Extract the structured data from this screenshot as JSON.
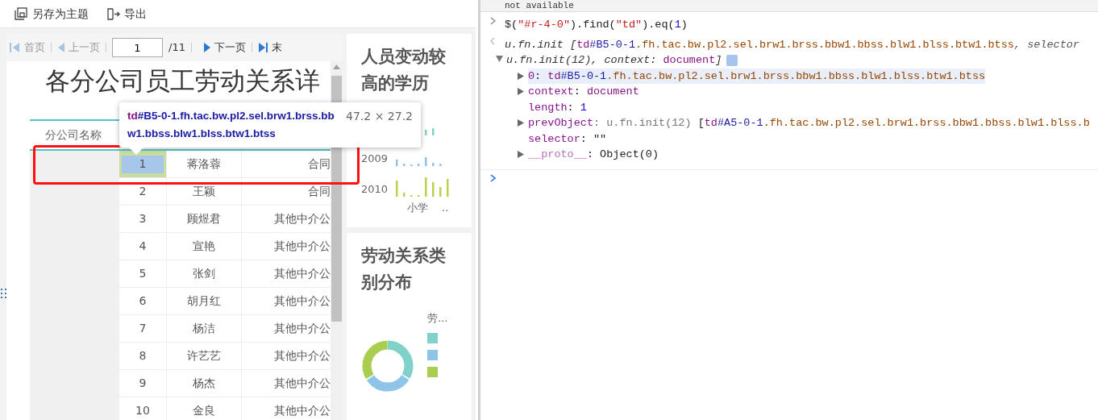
{
  "toolbar": {
    "buttons": [
      {
        "label": "另存为主题",
        "kind": "save"
      },
      {
        "label": "导出",
        "kind": "export"
      }
    ]
  },
  "pager": {
    "items": [
      {
        "label": "首页",
        "kind": "first",
        "disabled": true
      },
      {
        "label": "上一页",
        "kind": "prev",
        "disabled": true
      },
      {
        "label": "下一页",
        "kind": "next",
        "disabled": false
      },
      {
        "label": "末",
        "kind": "last",
        "disabled": false
      }
    ],
    "page": "1",
    "total": "/11"
  },
  "report": {
    "title": "各分公司员工劳动关系详",
    "header": "分公司名称",
    "rows": [
      {
        "number": "1",
        "name": "蒋洛蓉",
        "type": "合同",
        "selected": true
      },
      {
        "number": "2",
        "name": "王颖",
        "type": "合同",
        "selected": false
      },
      {
        "number": "3",
        "name": "顾煜君",
        "type": "其他中介公",
        "selected": false
      },
      {
        "number": "4",
        "name": "宣艳",
        "type": "其他中介公",
        "selected": false
      },
      {
        "number": "5",
        "name": "张剑",
        "type": "其他中介公",
        "selected": false
      },
      {
        "number": "6",
        "name": "胡月红",
        "type": "其他中介公",
        "selected": false
      },
      {
        "number": "7",
        "name": "杨洁",
        "type": "其他中介公",
        "selected": false
      },
      {
        "number": "8",
        "name": "许艺艺",
        "type": "其他中介公",
        "selected": false
      },
      {
        "number": "9",
        "name": "杨杰",
        "type": "其他中介公",
        "selected": false
      },
      {
        "number": "10",
        "name": "金良",
        "type": "其他中介公",
        "selected": false
      }
    ]
  },
  "inspector_tooltip": {
    "tag": "td",
    "id": "#B5-0-1",
    "classes": ".fh.tac.bw.pl2.sel.brw1.brss.bbw1.bbss.blw1.blss.btw1.btss",
    "size": "47.2 × 27.2"
  },
  "charts": [
    {
      "kind": "bars",
      "title": "人员变动较高的学历",
      "years": [
        "2009",
        "2010"
      ],
      "x_labels": [
        "小学",
        ".."
      ]
    },
    {
      "kind": "donut",
      "title": "劳动关系类别分布",
      "legend_title": "劳...",
      "legend": [
        {
          "color": "#7fd1c9"
        },
        {
          "color": "#8ec3ea"
        },
        {
          "color": "#a9cd4e"
        }
      ]
    }
  ],
  "console": {
    "top_message": "not available",
    "lines": [
      {
        "kind": "input",
        "segments": [
          {
            "text": "$(",
            "kind": "plain"
          },
          {
            "text": "\"#r-4-0\"",
            "kind": "string"
          },
          {
            "text": ").find(",
            "kind": "plain"
          },
          {
            "text": "\"td\"",
            "kind": "string"
          },
          {
            "text": ").eq(",
            "kind": "plain"
          },
          {
            "text": "1",
            "kind": "number"
          },
          {
            "text": ")",
            "kind": "plain"
          }
        ]
      },
      {
        "kind": "result",
        "segments": [
          {
            "text": "u.fn.init [",
            "kind": "italic"
          },
          {
            "text": "td",
            "kind": "tag"
          },
          {
            "text": "#B5-0-1",
            "kind": "id"
          },
          {
            "text": ".fh.tac.bw.pl2.sel.brw1.brss.bbw1.bbss.blw1.blss.btw1.btss",
            "kind": "cls"
          },
          {
            "text": ", selector",
            "kind": "italicgray"
          }
        ]
      },
      {
        "kind": "continuation",
        "segments": [
          {
            "text": "u.fn.init(12), context: ",
            "kind": "italic"
          },
          {
            "text": "document",
            "kind": "keyword"
          },
          {
            "text": "]",
            "kind": "italic"
          }
        ]
      },
      {
        "kind": "entry",
        "selected": true,
        "segments": [
          {
            "text": "0",
            "kind": "key"
          },
          {
            "text": ": ",
            "kind": "plain"
          },
          {
            "text": "td",
            "kind": "tag"
          },
          {
            "text": "#B5-0-1",
            "kind": "id"
          },
          {
            "text": ".fh.tac.bw.pl2.sel.brw1.brss.bbw1.bbss.blw1.blss.btw1.btss",
            "kind": "cls"
          }
        ]
      },
      {
        "kind": "entry",
        "selected": false,
        "segments": [
          {
            "text": "context",
            "kind": "key"
          },
          {
            "text": ": ",
            "kind": "plain"
          },
          {
            "text": "document",
            "kind": "keyword"
          }
        ]
      },
      {
        "kind": "leaf",
        "selected": false,
        "segments": [
          {
            "text": "length",
            "kind": "key"
          },
          {
            "text": ": ",
            "kind": "plain"
          },
          {
            "text": "1",
            "kind": "number"
          }
        ]
      },
      {
        "kind": "entry",
        "selected": false,
        "segments": [
          {
            "text": "prevObject",
            "kind": "key"
          },
          {
            "text": ": u.fn.init(12) ",
            "kind": "gray"
          },
          {
            "text": "[",
            "kind": "plain"
          },
          {
            "text": "td",
            "kind": "tag"
          },
          {
            "text": "#A5-0-1",
            "kind": "id"
          },
          {
            "text": ".fh.tac.bw.pl2.sel.brw1.brss.bbw1.bbss.blw1.blss.b",
            "kind": "cls"
          }
        ]
      },
      {
        "kind": "leaf",
        "selected": false,
        "segments": [
          {
            "text": "selector",
            "kind": "key"
          },
          {
            "text": ": ",
            "kind": "plain"
          },
          {
            "text": "\"\"",
            "kind": "plain"
          }
        ]
      },
      {
        "kind": "entry",
        "selected": false,
        "segments": [
          {
            "text": "__proto__",
            "kind": "protokey"
          },
          {
            "text": ": Object(0)",
            "kind": "plain"
          }
        ]
      },
      {
        "kind": "prompt"
      }
    ]
  }
}
